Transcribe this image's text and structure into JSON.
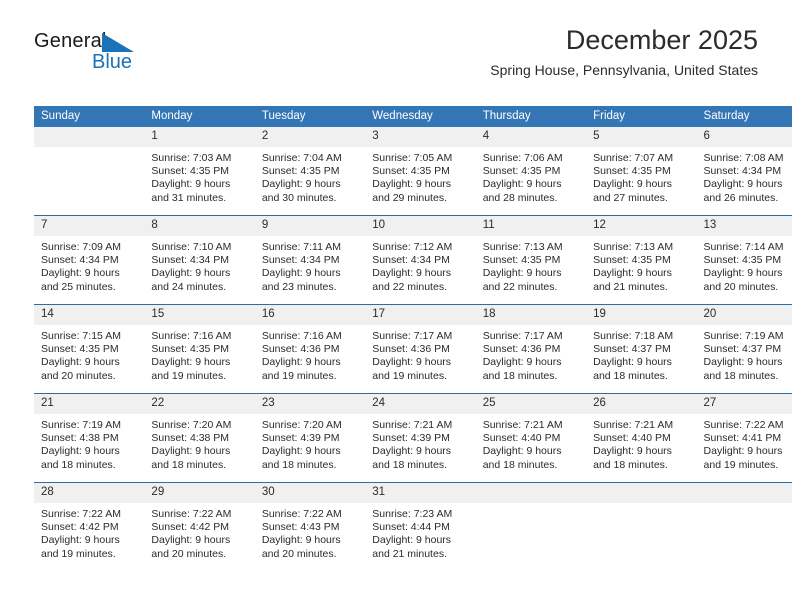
{
  "brand": {
    "name_part1": "General",
    "name_part2": "Blue",
    "triangle_icon": "blue-triangle-logo-mark",
    "accent_color": "#1b72b8"
  },
  "header": {
    "title": "December 2025",
    "subtitle": "Spring House, Pennsylvania, United States"
  },
  "calendar": {
    "header_bg": "#3476b5",
    "daynum_bg": "#f0f0f0",
    "row_border": "#2e6da4",
    "weekdays": [
      "Sunday",
      "Monday",
      "Tuesday",
      "Wednesday",
      "Thursday",
      "Friday",
      "Saturday"
    ],
    "weeks": [
      [
        {
          "day": "",
          "lines": []
        },
        {
          "day": "1",
          "lines": [
            "Sunrise: 7:03 AM",
            "Sunset: 4:35 PM",
            "Daylight: 9 hours",
            "and 31 minutes."
          ]
        },
        {
          "day": "2",
          "lines": [
            "Sunrise: 7:04 AM",
            "Sunset: 4:35 PM",
            "Daylight: 9 hours",
            "and 30 minutes."
          ]
        },
        {
          "day": "3",
          "lines": [
            "Sunrise: 7:05 AM",
            "Sunset: 4:35 PM",
            "Daylight: 9 hours",
            "and 29 minutes."
          ]
        },
        {
          "day": "4",
          "lines": [
            "Sunrise: 7:06 AM",
            "Sunset: 4:35 PM",
            "Daylight: 9 hours",
            "and 28 minutes."
          ]
        },
        {
          "day": "5",
          "lines": [
            "Sunrise: 7:07 AM",
            "Sunset: 4:35 PM",
            "Daylight: 9 hours",
            "and 27 minutes."
          ]
        },
        {
          "day": "6",
          "lines": [
            "Sunrise: 7:08 AM",
            "Sunset: 4:34 PM",
            "Daylight: 9 hours",
            "and 26 minutes."
          ]
        }
      ],
      [
        {
          "day": "7",
          "lines": [
            "Sunrise: 7:09 AM",
            "Sunset: 4:34 PM",
            "Daylight: 9 hours",
            "and 25 minutes."
          ]
        },
        {
          "day": "8",
          "lines": [
            "Sunrise: 7:10 AM",
            "Sunset: 4:34 PM",
            "Daylight: 9 hours",
            "and 24 minutes."
          ]
        },
        {
          "day": "9",
          "lines": [
            "Sunrise: 7:11 AM",
            "Sunset: 4:34 PM",
            "Daylight: 9 hours",
            "and 23 minutes."
          ]
        },
        {
          "day": "10",
          "lines": [
            "Sunrise: 7:12 AM",
            "Sunset: 4:34 PM",
            "Daylight: 9 hours",
            "and 22 minutes."
          ]
        },
        {
          "day": "11",
          "lines": [
            "Sunrise: 7:13 AM",
            "Sunset: 4:35 PM",
            "Daylight: 9 hours",
            "and 22 minutes."
          ]
        },
        {
          "day": "12",
          "lines": [
            "Sunrise: 7:13 AM",
            "Sunset: 4:35 PM",
            "Daylight: 9 hours",
            "and 21 minutes."
          ]
        },
        {
          "day": "13",
          "lines": [
            "Sunrise: 7:14 AM",
            "Sunset: 4:35 PM",
            "Daylight: 9 hours",
            "and 20 minutes."
          ]
        }
      ],
      [
        {
          "day": "14",
          "lines": [
            "Sunrise: 7:15 AM",
            "Sunset: 4:35 PM",
            "Daylight: 9 hours",
            "and 20 minutes."
          ]
        },
        {
          "day": "15",
          "lines": [
            "Sunrise: 7:16 AM",
            "Sunset: 4:35 PM",
            "Daylight: 9 hours",
            "and 19 minutes."
          ]
        },
        {
          "day": "16",
          "lines": [
            "Sunrise: 7:16 AM",
            "Sunset: 4:36 PM",
            "Daylight: 9 hours",
            "and 19 minutes."
          ]
        },
        {
          "day": "17",
          "lines": [
            "Sunrise: 7:17 AM",
            "Sunset: 4:36 PM",
            "Daylight: 9 hours",
            "and 19 minutes."
          ]
        },
        {
          "day": "18",
          "lines": [
            "Sunrise: 7:17 AM",
            "Sunset: 4:36 PM",
            "Daylight: 9 hours",
            "and 18 minutes."
          ]
        },
        {
          "day": "19",
          "lines": [
            "Sunrise: 7:18 AM",
            "Sunset: 4:37 PM",
            "Daylight: 9 hours",
            "and 18 minutes."
          ]
        },
        {
          "day": "20",
          "lines": [
            "Sunrise: 7:19 AM",
            "Sunset: 4:37 PM",
            "Daylight: 9 hours",
            "and 18 minutes."
          ]
        }
      ],
      [
        {
          "day": "21",
          "lines": [
            "Sunrise: 7:19 AM",
            "Sunset: 4:38 PM",
            "Daylight: 9 hours",
            "and 18 minutes."
          ]
        },
        {
          "day": "22",
          "lines": [
            "Sunrise: 7:20 AM",
            "Sunset: 4:38 PM",
            "Daylight: 9 hours",
            "and 18 minutes."
          ]
        },
        {
          "day": "23",
          "lines": [
            "Sunrise: 7:20 AM",
            "Sunset: 4:39 PM",
            "Daylight: 9 hours",
            "and 18 minutes."
          ]
        },
        {
          "day": "24",
          "lines": [
            "Sunrise: 7:21 AM",
            "Sunset: 4:39 PM",
            "Daylight: 9 hours",
            "and 18 minutes."
          ]
        },
        {
          "day": "25",
          "lines": [
            "Sunrise: 7:21 AM",
            "Sunset: 4:40 PM",
            "Daylight: 9 hours",
            "and 18 minutes."
          ]
        },
        {
          "day": "26",
          "lines": [
            "Sunrise: 7:21 AM",
            "Sunset: 4:40 PM",
            "Daylight: 9 hours",
            "and 18 minutes."
          ]
        },
        {
          "day": "27",
          "lines": [
            "Sunrise: 7:22 AM",
            "Sunset: 4:41 PM",
            "Daylight: 9 hours",
            "and 19 minutes."
          ]
        }
      ],
      [
        {
          "day": "28",
          "lines": [
            "Sunrise: 7:22 AM",
            "Sunset: 4:42 PM",
            "Daylight: 9 hours",
            "and 19 minutes."
          ]
        },
        {
          "day": "29",
          "lines": [
            "Sunrise: 7:22 AM",
            "Sunset: 4:42 PM",
            "Daylight: 9 hours",
            "and 20 minutes."
          ]
        },
        {
          "day": "30",
          "lines": [
            "Sunrise: 7:22 AM",
            "Sunset: 4:43 PM",
            "Daylight: 9 hours",
            "and 20 minutes."
          ]
        },
        {
          "day": "31",
          "lines": [
            "Sunrise: 7:23 AM",
            "Sunset: 4:44 PM",
            "Daylight: 9 hours",
            "and 21 minutes."
          ]
        },
        {
          "day": "",
          "lines": []
        },
        {
          "day": "",
          "lines": []
        },
        {
          "day": "",
          "lines": []
        }
      ]
    ]
  }
}
